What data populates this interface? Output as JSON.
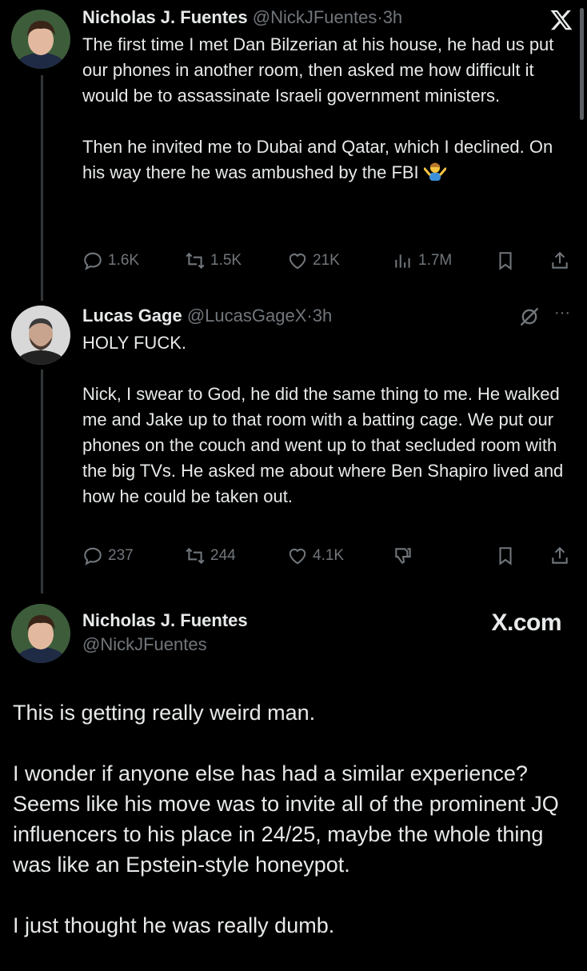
{
  "tweet1": {
    "name": "Nicholas J. Fuentes",
    "handle": "@NickJFuentes",
    "sep": "·",
    "time": "3h",
    "lines": [
      "The first time I met Dan Bilzerian at his house, he had us put our phones in another room, then asked me how difficult it would be to assassinate Israeli government ministers.",
      "Then he invited me to Dubai and Qatar, which I declined. On his way there he was ambushed by the FBI"
    ],
    "emoji": "shrugging-person-emoji",
    "replies": "1.6K",
    "reposts": "1.5K",
    "likes": "21K",
    "views": "1.7M"
  },
  "tweet2": {
    "name": "Lucas Gage",
    "handle": "@LucasGageX",
    "sep": "·",
    "time": "3h",
    "lines": [
      "HOLY FUCK.",
      "Nick, I swear to God, he did the same thing to me. He walked me and Jake up to that room with a batting cage. We put our phones on the couch and went up to that secluded room with the big TVs. He asked me about where Ben Shapiro lived and how he could be taken out."
    ],
    "replies": "237",
    "reposts": "244",
    "likes": "4.1K",
    "more": "···"
  },
  "tweet3": {
    "name": "Nicholas J. Fuentes",
    "handle": "@NickJFuentes",
    "brand": "X.com",
    "paragraphs": [
      "This is getting really weird man.",
      "I wonder if anyone else has had a similar experience? Seems like his move was to invite all of the prominent JQ influencers to his place in 24/25, maybe the whole thing was like an Epstein-style honeypot.",
      "I just thought he was really dumb."
    ]
  },
  "colors": {
    "background": "#000000",
    "text": "#e7e9ea",
    "muted": "#71767b",
    "thread_line": "#333639"
  }
}
